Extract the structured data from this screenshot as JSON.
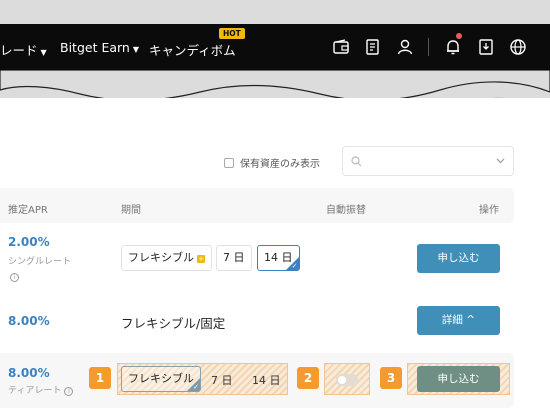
{
  "nav": {
    "trade_label": "レード",
    "earn_label": "Bitget Earn",
    "candy_label": "キャンディボム",
    "hot_badge": "HOT"
  },
  "filter": {
    "holdings_only_label": "保有資産のみ表示",
    "search_value": ""
  },
  "table": {
    "headers": {
      "apr": "推定APR",
      "period": "期間",
      "auto_renew": "自動振替",
      "action": "操作"
    },
    "rows": [
      {
        "apr": "2.00%",
        "rate_type": "シングルレート",
        "periods": [
          "フレキシブル",
          "7 日",
          "14 日"
        ],
        "selected_period": "14 日",
        "button": "申し込む"
      },
      {
        "apr": "8.00%",
        "mode": "フレキシブル/固定",
        "button": "詳細 ^"
      },
      {
        "apr": "8.00%",
        "rate_type": "ティアレート",
        "periods": [
          "フレキシブル",
          "7 日",
          "14 日"
        ],
        "selected_period": "フレキシブル",
        "button": "申し込む"
      }
    ]
  },
  "guide_badges": [
    "1",
    "2",
    "3"
  ],
  "colors": {
    "navbar": "#0b0b0b",
    "accent": "#3b82c4",
    "button": "#3f8fb8",
    "hot": "#f0b90b",
    "guide": "#f59a2e"
  }
}
